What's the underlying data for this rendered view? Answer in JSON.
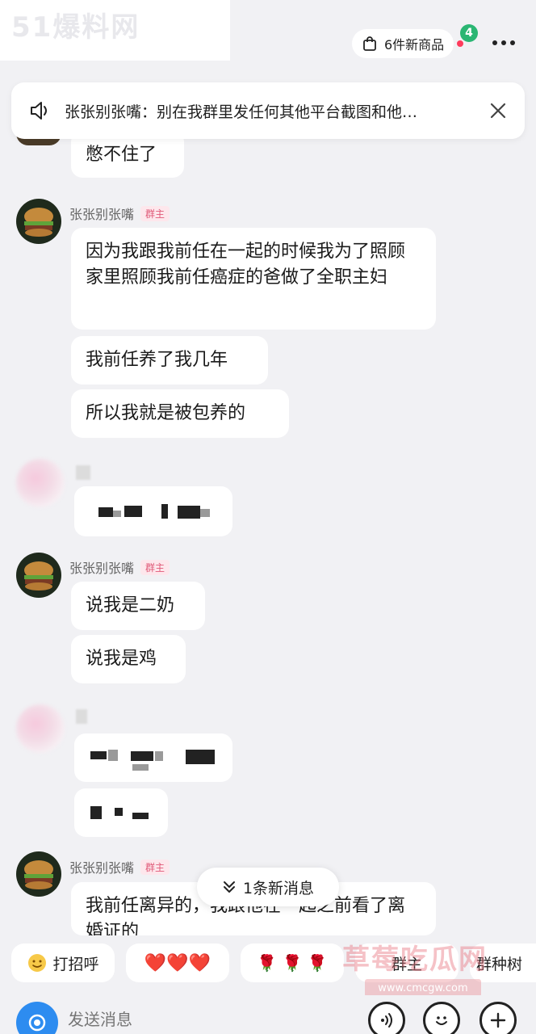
{
  "top": {
    "watermark": "51爆料网",
    "new_products_label": "6件新商品",
    "badge_count": "4"
  },
  "announcement": {
    "text": "张张别张嘴：别在我群里发任何其他平台截图和他…"
  },
  "messages": {
    "partial_top": "憋不住了",
    "group1": {
      "sender": "张张别张嘴",
      "role": "群主",
      "bubbles": [
        "因为我跟我前任在一起的时候我为了照顾家里照顾我前任癌症的爸做了全职主妇",
        "我前任养了我几年",
        "所以我就是被包养的"
      ]
    },
    "group2": {
      "sender": "张张别张嘴",
      "role": "群主",
      "bubbles": [
        "说我是二奶",
        "说我是鸡"
      ]
    },
    "group3": {
      "sender": "张张别张嘴",
      "role": "群主",
      "bubble_partial": "我前任离异的，我跟他在一起之前看了离婚证的"
    }
  },
  "new_messages_label": "1条新消息",
  "quick_replies": {
    "greet": "打招呼",
    "hearts": "❤️❤️❤️",
    "roses": "🌹 🌹 🌹",
    "group_owner": "群主",
    "group_type": "群种树"
  },
  "bottom_watermark": {
    "name": "草莓吃瓜网",
    "url": "www.cmcgw.com"
  },
  "input": {
    "placeholder": "发送消息"
  },
  "colors": {
    "accent_blue": "#2d8cf0",
    "badge_green": "#2bb673",
    "role_tag": "#e05a78"
  }
}
